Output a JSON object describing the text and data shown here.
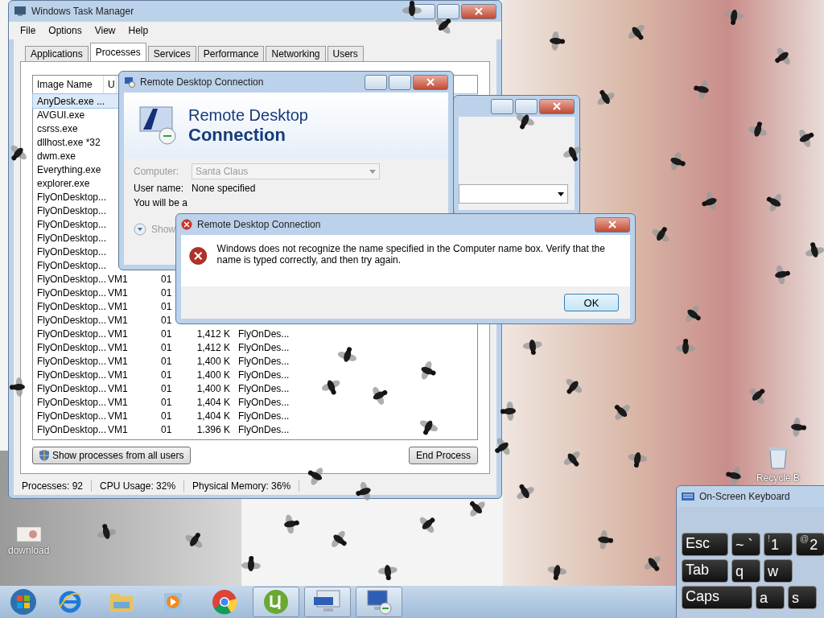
{
  "desktop": {
    "icons": [
      {
        "label": "download",
        "kind": "image"
      },
      {
        "label": "Recycle B",
        "kind": "bin"
      }
    ]
  },
  "task_manager": {
    "title": "Windows Task Manager",
    "menu": [
      "File",
      "Options",
      "View",
      "Help"
    ],
    "tabs": [
      {
        "label": "Applications",
        "selected": false
      },
      {
        "label": "Processes",
        "selected": true
      },
      {
        "label": "Services",
        "selected": false
      },
      {
        "label": "Performance",
        "selected": false
      },
      {
        "label": "Networking",
        "selected": false
      },
      {
        "label": "Users",
        "selected": false
      }
    ],
    "columns": [
      "Image Name",
      "U"
    ],
    "rows": [
      {
        "name": "AnyDesk.exe ...",
        "selected": true
      },
      {
        "name": "AVGUI.exe",
        "selected": false
      },
      {
        "name": "csrss.exe",
        "selected": false
      },
      {
        "name": "dllhost.exe *32",
        "selected": false
      },
      {
        "name": "dwm.exe",
        "selected": false
      },
      {
        "name": "Everything.exe",
        "selected": false
      },
      {
        "name": "explorer.exe",
        "selected": false
      },
      {
        "name": "FlyOnDesktop...",
        "selected": false
      },
      {
        "name": "FlyOnDesktop...",
        "selected": false
      },
      {
        "name": "FlyOnDesktop...",
        "selected": false
      },
      {
        "name": "FlyOnDesktop...",
        "selected": false
      },
      {
        "name": "FlyOnDesktop...",
        "selected": false
      },
      {
        "name": "FlyOnDesktop...",
        "selected": false
      },
      {
        "name": "FlyOnDesktop...",
        "user": "VM1",
        "cpu": "01",
        "selected": false
      },
      {
        "name": "FlyOnDesktop...",
        "user": "VM1",
        "cpu": "01",
        "selected": false
      },
      {
        "name": "FlyOnDesktop...",
        "user": "VM1",
        "cpu": "01",
        "selected": false
      },
      {
        "name": "FlyOnDesktop...",
        "user": "VM1",
        "cpu": "01",
        "selected": false
      },
      {
        "name": "FlyOnDesktop...",
        "user": "VM1",
        "cpu": "01",
        "memory": "1,412 K",
        "description": "FlyOnDes...",
        "selected": false
      },
      {
        "name": "FlyOnDesktop...",
        "user": "VM1",
        "cpu": "01",
        "memory": "1,412 K",
        "description": "FlyOnDes...",
        "selected": false
      },
      {
        "name": "FlyOnDesktop...",
        "user": "VM1",
        "cpu": "01",
        "memory": "1,400 K",
        "description": "FlyOnDes...",
        "selected": false
      },
      {
        "name": "FlyOnDesktop...",
        "user": "VM1",
        "cpu": "01",
        "memory": "1,400 K",
        "description": "FlyOnDes...",
        "selected": false
      },
      {
        "name": "FlyOnDesktop...",
        "user": "VM1",
        "cpu": "01",
        "memory": "1,400 K",
        "description": "FlyOnDes...",
        "selected": false
      },
      {
        "name": "FlyOnDesktop...",
        "user": "VM1",
        "cpu": "01",
        "memory": "1,404 K",
        "description": "FlyOnDes...",
        "selected": false
      },
      {
        "name": "FlyOnDesktop...",
        "user": "VM1",
        "cpu": "01",
        "memory": "1,404 K",
        "description": "FlyOnDes...",
        "selected": false
      },
      {
        "name": "FlyOnDesktop...",
        "user": "VM1",
        "cpu": "01",
        "memory": "1.396 K",
        "description": "FlyOnDes...",
        "selected": false
      }
    ],
    "buttons": [
      "Show processes from all users",
      "End Process"
    ],
    "status_bar": [
      "Processes: 92",
      "CPU Usage: 32%",
      "Physical Memory: 36%"
    ]
  },
  "rdc_window": {
    "title": "Remote Desktop Connection",
    "banner": [
      "Remote Desktop",
      "Connection"
    ],
    "computer_label": "Computer:",
    "computer_value": "Santa Claus",
    "computer_disabled": true,
    "user_label": "User name:",
    "user_value": "None specified",
    "note": "You will be a",
    "options_toggle": "Show"
  },
  "error_dialog": {
    "title": "Remote Desktop Connection",
    "message": "Windows does not recognize the name specified in the Computer name box. Verify that the name is typed correctly, and then try again.",
    "button": "OK"
  },
  "keyboard": {
    "title": "On-Screen Keyboard",
    "rows": [
      {
        "keys": [
          {
            "label": "Esc",
            "kind": "wide"
          },
          {
            "label": "~ `",
            "kind": "key"
          },
          {
            "top": "!",
            "label": "1",
            "kind": "key"
          },
          {
            "top": "@",
            "label": "2",
            "kind": "key"
          }
        ]
      },
      {
        "keys": [
          {
            "label": "Tab",
            "kind": "wide"
          },
          {
            "label": "q",
            "kind": "key"
          },
          {
            "label": "w",
            "kind": "key"
          }
        ]
      },
      {
        "keys": [
          {
            "label": "Caps",
            "kind": "wider"
          },
          {
            "label": "a",
            "kind": "key"
          },
          {
            "label": "s",
            "kind": "key"
          }
        ]
      }
    ]
  },
  "taskbar": {
    "items": [
      {
        "kind": "start",
        "active": false
      },
      {
        "kind": "ie",
        "active": false
      },
      {
        "kind": "folder",
        "active": false
      },
      {
        "kind": "media",
        "active": false
      },
      {
        "kind": "chrome",
        "active": false
      },
      {
        "kind": "torrent",
        "active": true
      },
      {
        "kind": "keyboard",
        "active": true
      },
      {
        "kind": "rdc",
        "active": true
      }
    ]
  }
}
